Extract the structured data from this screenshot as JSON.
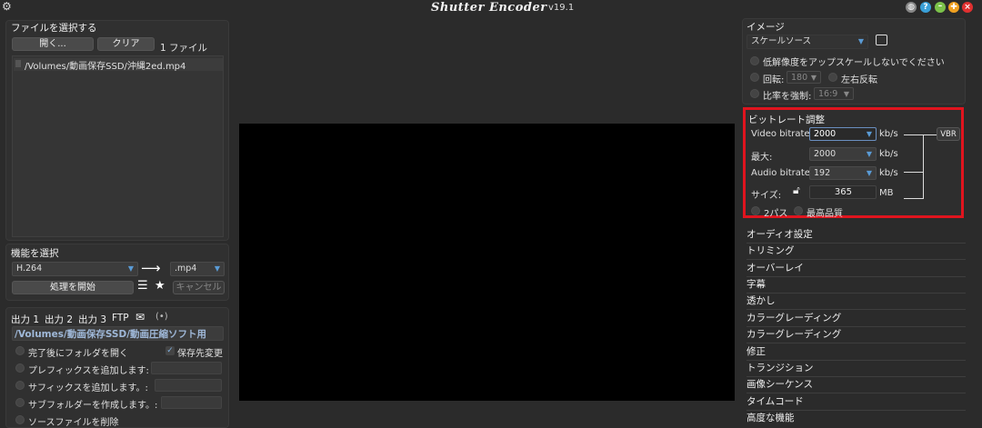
{
  "window": {
    "title": "Shutter Encoder",
    "version": "v19.1",
    "buttons": {
      "help": "?",
      "info": "i",
      "minimize": "–",
      "close": "×"
    },
    "colors": {
      "help": "#3aa0d8",
      "info": "#6aa0d0",
      "minimize": "#7cc24a",
      "zoom": "#f0a020",
      "close": "#e03030"
    }
  },
  "files": {
    "section_title": "ファイルを選択する",
    "open_label": "開く...",
    "clear_label": "クリア",
    "count_label": "1 ファイル",
    "items": [
      "/Volumes/動画保存SSD/沖縄2ed.mp4"
    ]
  },
  "function": {
    "section_title": "機能を選択",
    "codec": "H.264",
    "container": ".mp4",
    "start_label": "処理を開始",
    "cancel_label": "キャンセル"
  },
  "output": {
    "tabs": [
      "出力 1",
      "出力 2",
      "出力 3",
      "FTP"
    ],
    "path": "/Volumes/動画保存SSD/動画圧縮ソフト用",
    "open_folder_label": "完了後にフォルダを開く",
    "save_dest_label": "保存先変更",
    "prefix_label": "プレフィックスを追加します:",
    "suffix_label": "サフィックスを追加します。:",
    "subfolder_label": "サブフォルダーを作成します。:",
    "delete_source_label": "ソースファイルを削除"
  },
  "image": {
    "section_title": "イメージ",
    "scale_value": "スケールソース",
    "no_upscale_label": "低解像度をアップスケールしないでください",
    "rotate_label": "回転:",
    "rotate_value": "180",
    "flip_label": "左右反転",
    "aspect_label": "比率を強制:",
    "aspect_value": "16:9"
  },
  "bitrate": {
    "section_title": "ビットレート調整",
    "video_label": "Video bitrate:",
    "video_value": "2000",
    "max_label": "最大:",
    "max_value": "2000",
    "audio_label": "Audio bitrate:",
    "audio_value": "192",
    "size_label": "サイズ:",
    "size_value": "365",
    "unit_kbs": "kb/s",
    "unit_mb": "MB",
    "vbr_label": "VBR",
    "two_pass_label": "2パス",
    "best_quality_label": "最高品質",
    "highlight_color": "#e0141e"
  },
  "sections": [
    "オーディオ設定",
    "トリミング",
    "オーバーレイ",
    "字幕",
    "透かし",
    "カラーグレーディング",
    "カラーグレーディング",
    "修正",
    "トランジション",
    "画像シーケンス",
    "タイムコード",
    "高度な機能"
  ]
}
